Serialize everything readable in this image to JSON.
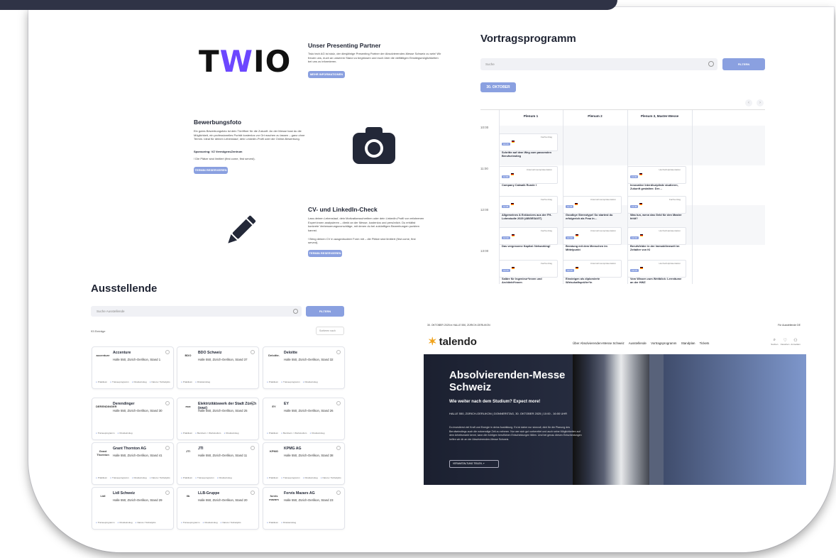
{
  "partner": {
    "logo": "TWIO",
    "title": "Unser Presenting Partner",
    "text": "Twio tech AG ist stolz, der diesjährige Presenting Partner der Absolvierenden-Messe Schweiz zu sein! Wir freuen uns, euch an unserem Stand zu begrüssen und euch über die vielfältigen Einstiegsmöglichkeiten bei uns zu informieren.",
    "button": "MEHR INFORMATIONEN"
  },
  "photo": {
    "title": "Bewerbungsfoto",
    "text": "Ein gutes Bewerbungsfoto ist dein Türöffner für die Zukunft. An der Messe hast du die Möglichkeit, ein professionelles Porträt kostenlos vor Ort machen zu lassen – ganz ohne Termin. Ideal für deinen Lebenslauf, dein LinkedIn-Profil oder die Online-Bewerbung.",
    "sponsor": "Sponsoring: VZ VermögensZentrum",
    "note": "! Die Plätze sind limitiert (first come, first served).",
    "button": "TERMIN RESERVIEREN"
  },
  "cv": {
    "title": "CV- und LinkedIn-Check",
    "text": "Lass deinen Lebenslauf, dein Motivationsschreiben oder dein LinkedIn-Profil von erfahrenen Expert:innen analysieren – direkt an der Messe, kostenlos und persönlich. Du erhältst konkrete Verbesserungsvorschläge, mit denen du bei zukünftigen Bewerbungen punkten kannst.",
    "note": "! Bring deinen CV in ausgedruckter Form mit – die Plätze sind limitiert (first come, first served).",
    "button": "TERMIN RESERVIEREN"
  },
  "program": {
    "title": "Vortragsprogramm",
    "search_placeholder": "Suche",
    "filter": "FILTERN",
    "date": "30. OKTOBER",
    "prev": "‹",
    "next": "›",
    "columns": [
      "Plenum 1",
      "Plenum 2",
      "Plenum 3, Master-Messe"
    ],
    "times": [
      "10:00",
      "11:00",
      "12:00",
      "13:00"
    ],
    "sessions": [
      {
        "time": "10:15",
        "cat": "Fachvortrag",
        "title": "Schritte auf dem Weg zum passenden Berufseinstieg"
      },
      {
        "time": "11:00",
        "cat": "Unternehmenspräsentation",
        "title": "Company Catwalk Runde I"
      },
      {
        "time": "11:00",
        "cat": "Hochschulpräsentation",
        "title": "Innovative Interdisziplinär studieren, Zukunft gestalten: Der…"
      },
      {
        "time": "11:45",
        "cat": "Fachvortrag",
        "title": "Allgemeines & Exklusives aus der FH-Lohnstudie 2025 (ABGESAGT)"
      },
      {
        "time": "11:45",
        "cat": "Unternehmenspräsentation",
        "title": "Goodbye Stereotype! So startest du erfolgreich als Frau in…"
      },
      {
        "time": "11:45",
        "cat": "Fachvortrag",
        "title": "Was tun, wenn das Geld für den Master fehlt?"
      },
      {
        "time": "12:30",
        "cat": "Fachvortrag",
        "title": "Das vergessene Kapital: Networking!"
      },
      {
        "time": "12:30",
        "cat": "Unternehmenspräsentation",
        "title": "Beratung mit dem Menschen im Mittelpunkt"
      },
      {
        "time": "12:30",
        "cat": "Hochschulpräsentation",
        "title": "Berufsfelder in der Immobilienwelt im Zeitalter von KI"
      },
      {
        "time": "13:15",
        "cat": "Fachvortrag",
        "title": "Saläre für Ingenieur*innen und Architekt*innen"
      },
      {
        "time": "13:15",
        "cat": "Unternehmenspräsentation",
        "title": "Einsteigen als diplomierte Wirtschaftsprüfer*in"
      },
      {
        "time": "13:15",
        "cat": "Hochschulpräsentation",
        "title": "Vom Wissen zum Weitblick: Lernräume an der HWZ"
      }
    ]
  },
  "exhibitors": {
    "title": "Ausstellende",
    "search_placeholder": "Suche Ausstellende",
    "filter": "FILTERN",
    "count": "93 Einträge",
    "sort": "Sortieren nach",
    "items": [
      {
        "logo": "accenture",
        "name": "Accenture",
        "loc": "Halle 550, Zürich-Oerlikon, Stand 1",
        "tags": [
          "Praktikum",
          "Traineeprogramm",
          "Direkteinstieg",
          "Nature / Teilzeitjobs"
        ]
      },
      {
        "logo": "BDO",
        "name": "BDO Schweiz",
        "loc": "Halle 550, Zürich-Oerlikon, Stand 37",
        "tags": [
          "Praktikum",
          "Direkteinstieg"
        ]
      },
      {
        "logo": "Deloitte.",
        "name": "Deloitte",
        "loc": "Halle 550, Zürich-Oerlikon, Stand 32",
        "tags": [
          "Praktikum",
          "Traineeprogramm",
          "Direkteinstieg"
        ]
      },
      {
        "logo": "DERENDINGER",
        "name": "Derendinger",
        "loc": "Halle 550, Zürich-Oerlikon, Stand 30",
        "tags": [
          "Traineeprogramm",
          "Direkteinstieg"
        ]
      },
      {
        "logo": "ewz",
        "name": "Elektrizitätswerk der Stadt Zürich (ewz)",
        "loc": "Halle 550, Zürich-Oerlikon, Stand 25",
        "tags": [
          "Praktikum",
          "Berufsein. / Werkstudium",
          "Direkteinstieg"
        ]
      },
      {
        "logo": "EY",
        "name": "EY",
        "loc": "Halle 550, Zürich-Oerlikon, Stand 26",
        "tags": [
          "Praktikum",
          "Berufsein. / Werkstudium",
          "Direkteinstieg"
        ]
      },
      {
        "logo": "Grant Thornton",
        "name": "Grant Thornton AG",
        "loc": "Halle 550, Zürich-Oerlikon, Stand 41",
        "tags": [
          "Praktikum",
          "Traineeprogramm",
          "Direkteinstieg",
          "Nature / Teilzeitjobs"
        ]
      },
      {
        "logo": "JTI",
        "name": "JTI",
        "loc": "Halle 550, Zürich-Oerlikon, Stand 11",
        "tags": [
          "Praktikum",
          "Traineeprogramm",
          "Direkteinstieg"
        ]
      },
      {
        "logo": "KPMG",
        "name": "KPMG AG",
        "loc": "Halle 550, Zürich-Oerlikon, Stand 38",
        "tags": [
          "Praktikum",
          "Traineeprogramm",
          "Direkteinstieg",
          "Nature / Teilzeitjobs"
        ]
      },
      {
        "logo": "Lidl",
        "name": "Lidl Schweiz",
        "loc": "Halle 550, Zürich-Oerlikon, Stand 29",
        "tags": [
          "Traineeprogramm",
          "Direkteinstieg",
          "Nature / Teilzeitjobs"
        ]
      },
      {
        "logo": "llb",
        "name": "LLB-Gruppe",
        "loc": "Halle 550, Zürich-Oerlikon, Stand 20",
        "tags": [
          "Traineeprogramm",
          "Direkteinstieg",
          "Nature / Teilzeitjobs"
        ]
      },
      {
        "logo": "forvis mazars",
        "name": "Forvis Mazars AG",
        "loc": "Halle 550, Zürich-Oerlikon, Stand 23",
        "tags": [
          "Praktikum",
          "Direkteinstieg"
        ]
      }
    ]
  },
  "talendo": {
    "topline": "30. OKTOBER 2025 in HALLE 550, ZÜRICH-OERLIKON",
    "top_right": "Für Ausstellende   DE",
    "logo": "talendo",
    "nav": [
      "Über Absolvierenden-Messe Schweiz",
      "Ausstellende",
      "Vortragsprogramm",
      "Standplan",
      "Tickets"
    ],
    "icons": [
      "Suchen",
      "Favoriten",
      "Anmelden"
    ],
    "headline": "Absolvierenden-Messe Schweiz",
    "subhead": "Wie weiter nach dem Studium? Expect more!",
    "meta": "HALLE 550, ZÜRICH-OERLIKON | DONNERSTAG, 30. OKTOBER 2025 | 10:00 - 16:00 UHR",
    "body": "Du investierst viel Kraft und Energie in deine Ausbildung. Es ist daher nur sinnvoll, dich für die Planung des Berufseinstiegs auch die notwendige Zeit zu nehmen. Nur wer sich gut vorbereitet und auch seine Möglichkeiten auf dem Arbeitsmarkt kennt, kann die richtigen beruflichen Entscheidungen fällen. Und bei genau diesen Entscheidungen helfen wir dir an der Absolvierenden-Messe Schweiz.",
    "button": "VERANSTALTUNG TEILEN"
  }
}
